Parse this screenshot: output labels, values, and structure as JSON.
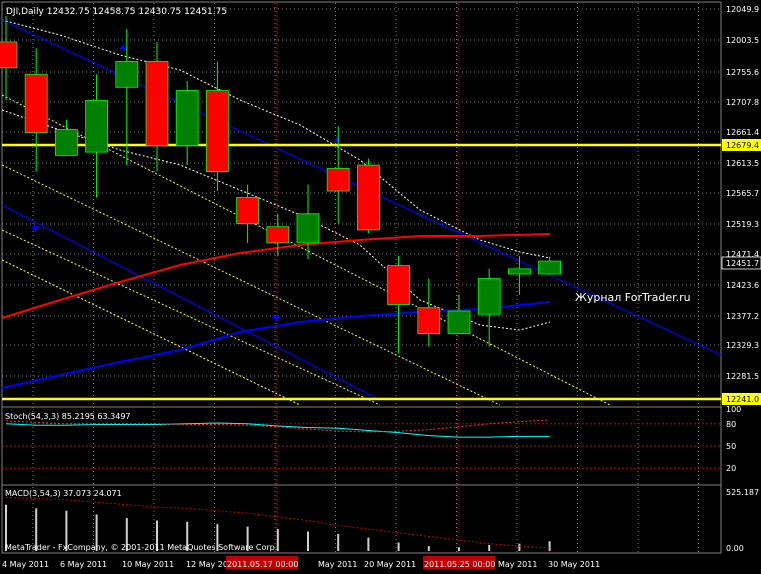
{
  "main": {
    "header": "DJI,Daily  12432.75 12458.75 12430.75 12451.75",
    "watermark": "Журнал ForTrader.ru",
    "price_tags": [
      "12049.9",
      "12003.5",
      "12755.6",
      "12707.8",
      "12661.4",
      "12613.5",
      "12565.7",
      "12519.3",
      "12471.4",
      "12423.6",
      "12377.2",
      "12329.3",
      "12281.5"
    ],
    "marked_prices": [
      {
        "label": "12679.4",
        "color": "#ffff00"
      },
      {
        "label": "12451.7",
        "color": "#ffffff"
      },
      {
        "label": "12241.0",
        "color": "#ffff00"
      }
    ]
  },
  "stoch": {
    "header": "Stoch(54,3,3) 85.2195 63.3497",
    "tags": [
      "100",
      "80",
      "50",
      "20"
    ]
  },
  "macd": {
    "header": "MACD(3,54,3) 37.073 24.071",
    "tags": [
      "525.187",
      "0.00"
    ],
    "footer": "MetaTrader - FxCompany, © 2001-2011 MetaQuotes Software Corp."
  },
  "dates": [
    {
      "label": "4 May 2011",
      "highlight": false
    },
    {
      "label": "6 May 2011",
      "highlight": false
    },
    {
      "label": "10 May 2011",
      "highlight": false
    },
    {
      "label": "12 May 2011",
      "highlight": false
    },
    {
      "label": "2011.05.17 00:00",
      "highlight": true
    },
    {
      "label": "May 2011",
      "highlight": false
    },
    {
      "label": "20 May 2011",
      "highlight": false
    },
    {
      "label": "2011.05.25 00:00",
      "highlight": true
    },
    {
      "label": "May 2011",
      "highlight": false
    },
    {
      "label": "30 May 2011",
      "highlight": false
    }
  ],
  "colors": {
    "bull": "#008000",
    "bear": "#ff0000",
    "wick": "#00ff00",
    "channel_main": "#0000ff",
    "ma_slow": "#0000ff",
    "ma_fast": "#ff0000",
    "channel_dotted": "#ffff00",
    "envelope": "#ffffff",
    "grid": "#808080"
  },
  "chart_data": [
    {
      "type": "candlestick",
      "title": "DJI,Daily",
      "candles": [
        {
          "o": 12790,
          "h": 12830,
          "l": 12700,
          "c": 12750
        },
        {
          "o": 12740,
          "h": 12780,
          "l": 12590,
          "c": 12650
        },
        {
          "o": 12615,
          "h": 12670,
          "l": 12620,
          "c": 12655
        },
        {
          "o": 12620,
          "h": 12740,
          "l": 12550,
          "c": 12700
        },
        {
          "o": 12720,
          "h": 12810,
          "l": 12600,
          "c": 12760
        },
        {
          "o": 12760,
          "h": 12790,
          "l": 12590,
          "c": 12630
        },
        {
          "o": 12630,
          "h": 12730,
          "l": 12600,
          "c": 12715
        },
        {
          "o": 12715,
          "h": 12760,
          "l": 12560,
          "c": 12590
        },
        {
          "o": 12550,
          "h": 12570,
          "l": 12480,
          "c": 12510
        },
        {
          "o": 12505,
          "h": 12525,
          "l": 12460,
          "c": 12480
        },
        {
          "o": 12480,
          "h": 12570,
          "l": 12455,
          "c": 12525
        },
        {
          "o": 12595,
          "h": 12660,
          "l": 12510,
          "c": 12560
        },
        {
          "o": 12600,
          "h": 12610,
          "l": 12495,
          "c": 12500
        },
        {
          "o": 12445,
          "h": 12460,
          "l": 12310,
          "c": 12385
        },
        {
          "o": 12380,
          "h": 12425,
          "l": 12320,
          "c": 12340
        },
        {
          "o": 12340,
          "h": 12400,
          "l": 12340,
          "c": 12375
        },
        {
          "o": 12370,
          "h": 12440,
          "l": 12320,
          "c": 12425
        },
        {
          "o": 12432,
          "h": 12460,
          "l": 12400,
          "c": 12440
        },
        {
          "o": 12432,
          "h": 12459,
          "l": 12431,
          "c": 12452
        }
      ],
      "ylim": [
        12230,
        12850
      ]
    },
    {
      "type": "line",
      "title": "Stoch(54,3,3)",
      "series": [
        {
          "values": [
            80,
            78,
            78,
            79,
            79,
            79,
            80,
            81,
            80,
            77,
            75,
            74,
            71,
            68,
            64,
            62,
            62,
            63,
            63
          ]
        },
        {
          "values": [
            84,
            82,
            80,
            80,
            80,
            80,
            79,
            79,
            78,
            76,
            73,
            70,
            69,
            70,
            72,
            76,
            80,
            83,
            85
          ]
        }
      ],
      "ylim": [
        0,
        100
      ]
    },
    {
      "type": "bar",
      "title": "MACD(3,54,3)",
      "values": [
        380,
        350,
        330,
        300,
        270,
        250,
        240,
        220,
        200,
        180,
        160,
        140,
        110,
        70,
        40,
        30,
        50,
        60,
        80
      ],
      "signal": [
        440,
        430,
        420,
        400,
        380,
        360,
        350,
        330,
        310,
        280,
        250,
        210,
        180,
        150,
        120,
        90,
        60,
        40,
        24
      ],
      "ylim": [
        0,
        525.187
      ]
    }
  ]
}
